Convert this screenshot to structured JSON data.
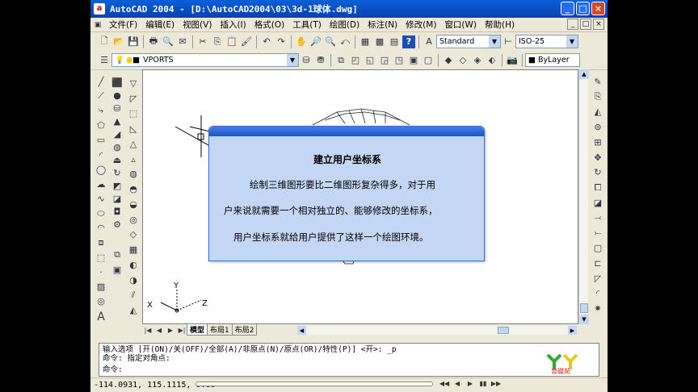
{
  "window": {
    "title": "AutoCAD 2004 - [D:\\AutoCAD2004\\03\\3d-1球体.dwg]",
    "app_icon": "a",
    "minimize": "_",
    "maximize": "□",
    "close": "×"
  },
  "menu": {
    "items": [
      "文件(F)",
      "编辑(E)",
      "视图(V)",
      "插入(I)",
      "格式(O)",
      "工具(T)",
      "绘图(D)",
      "标注(N)",
      "修改(M)",
      "窗口(W)",
      "帮助(H)"
    ]
  },
  "toolbar": {
    "text_style": "Standard",
    "dim_style": "ISO-25",
    "layer": "VPORTS",
    "color": "ByLayer"
  },
  "tabs": {
    "nav": [
      "|◀",
      "◀",
      "▶",
      "▶|"
    ],
    "items": [
      "模型",
      "布局1",
      "布局2"
    ]
  },
  "ucs": {
    "x": "X",
    "y": "Y",
    "z": "Z"
  },
  "dialog": {
    "title": "建立用户坐标系",
    "lines": [
      "绘制三维图形要比二维图形复杂得多，对于用",
      "户来说就需要一个相对独立的、能够修改的坐标系，",
      "用户坐标系就给用户提供了这样一个绘图环境。"
    ]
  },
  "command": {
    "lines": [
      "输入选项 [开(ON)/关(OFF)/全部(A)/非原点(N)/原点(OR)/特性(P)] <开>: _p",
      "命令: 指定对角点:",
      "命令:"
    ]
  },
  "status": {
    "coords": "-114.0931, 115.1115, 0.00"
  },
  "player": {
    "buttons": [
      "◀◀",
      "◀",
      "▶",
      "▮▮",
      "▶▶"
    ]
  },
  "colors": {
    "titlebar": "#0A5FD8",
    "dialog_bg": "#C3D6F3",
    "dialog_bar": "#2D6BD8"
  }
}
